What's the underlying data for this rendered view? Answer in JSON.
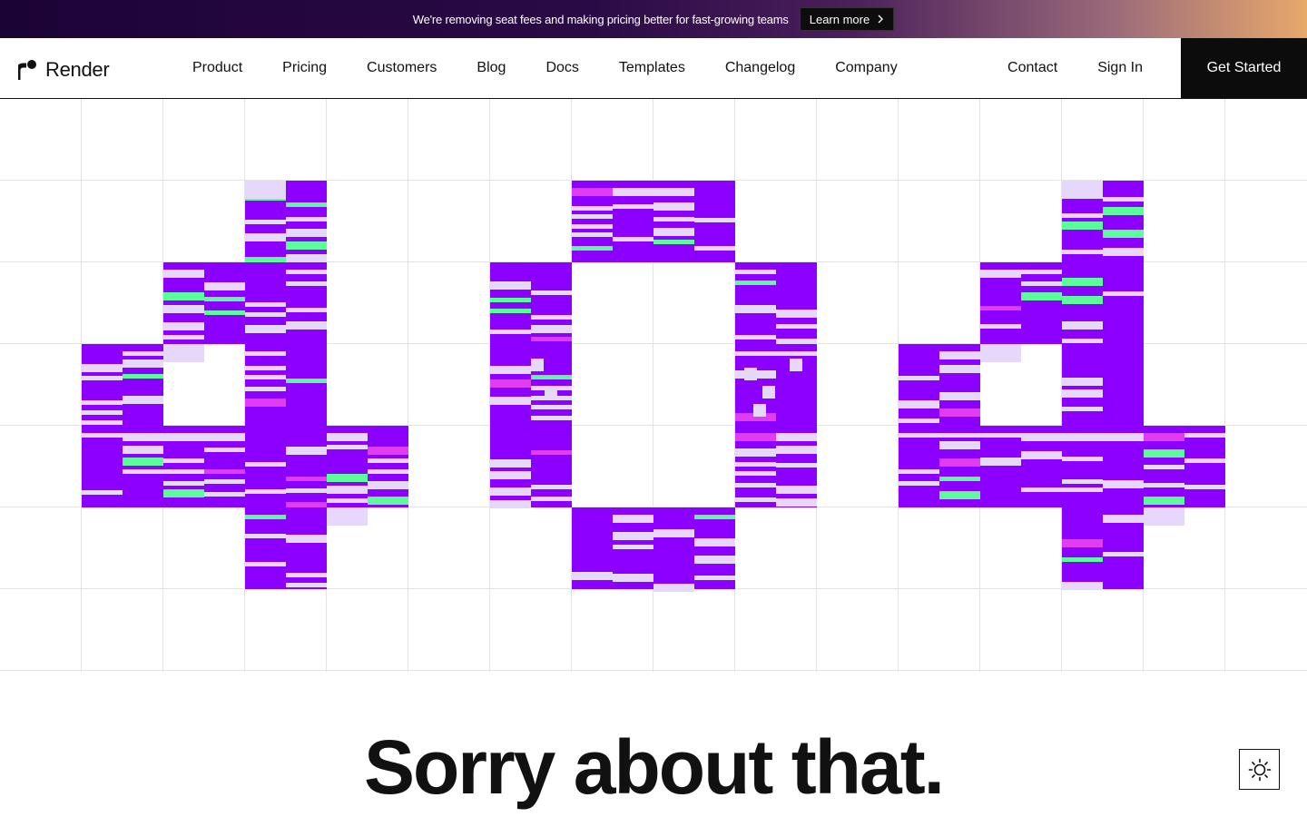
{
  "banner": {
    "text": "We're removing seat fees and making pricing better for fast-growing teams",
    "button_label": "Learn more"
  },
  "nav": {
    "brand": "Render",
    "links": [
      "Product",
      "Pricing",
      "Customers",
      "Blog",
      "Docs",
      "Templates",
      "Changelog",
      "Company"
    ],
    "contact": "Contact",
    "sign_in": "Sign In",
    "cta": "Get Started"
  },
  "illustration": {
    "glyphs": "404",
    "colors": {
      "purple": "#8b00ff",
      "lavender": "#e5d8fb",
      "mint": "#5dfc9b",
      "magenta": "#e13df0",
      "grid": "#e3e3e3"
    }
  },
  "main": {
    "heading": "Sorry about that."
  },
  "theme_toggle": {
    "icon": "sun-icon"
  }
}
